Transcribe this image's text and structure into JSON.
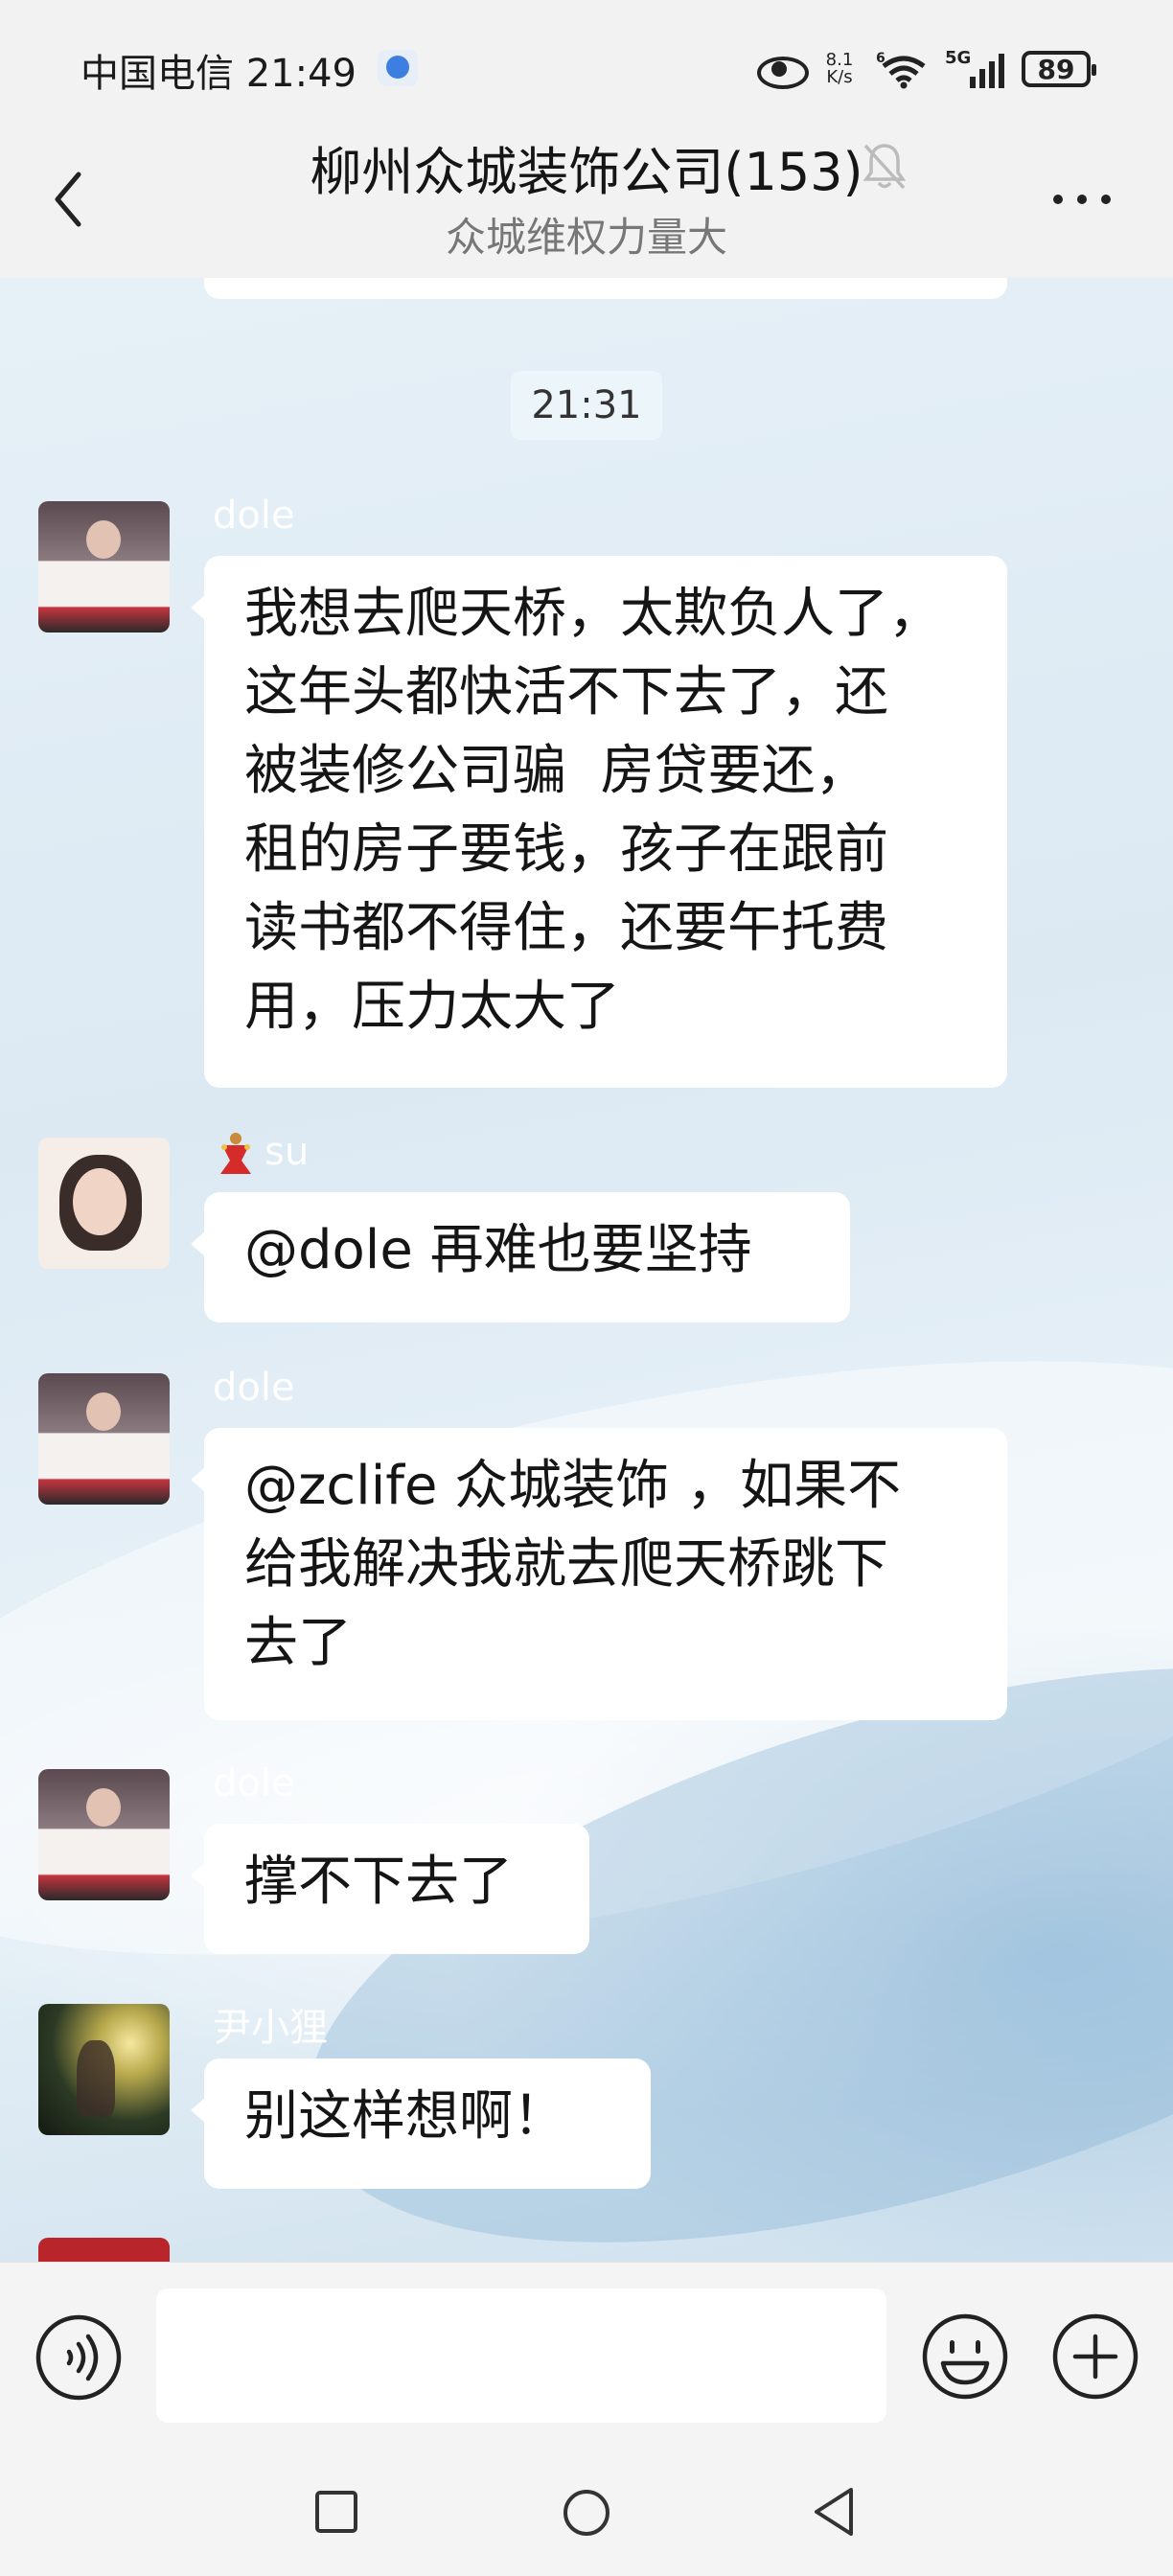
{
  "status_bar": {
    "carrier_time": "中国电信 21:49",
    "net_speed_value": "8.1",
    "net_speed_unit": "K/s",
    "network_gen": "5G",
    "wifi_gen": "6",
    "battery": "89"
  },
  "header": {
    "title": "柳州众城装饰公司(153)",
    "subtitle": "众城维权力量大"
  },
  "chat": {
    "time_divider": "21:31",
    "messages": [
      {
        "sender": "dole",
        "avatar_icon": "profile-photo",
        "text": "我想去爬天桥，太欺负人了，\n这年头都快活不下去了，还\n被装修公司骗  房贷要还，\n租的房子要钱，孩子在跟前\n读书都不得住，还要午托费\n用，压力太大了"
      },
      {
        "sender": "su",
        "avatar_icon": "profile-photo",
        "badge_icon": "dancer-emoji",
        "text": "@dole  再难也要坚持"
      },
      {
        "sender": "dole",
        "avatar_icon": "profile-photo",
        "text": "@zclife 众城装饰 ，如果不\n给我解决我就去爬天桥跳下\n去了"
      },
      {
        "sender": "dole",
        "avatar_icon": "profile-photo",
        "text": "撑不下去了"
      },
      {
        "sender": "尹小狸",
        "avatar_icon": "profile-photo",
        "text": "别这样想啊！"
      }
    ]
  },
  "input_bar": {
    "placeholder": "",
    "value": ""
  },
  "colors": {
    "header_bg": "#f2f2f2",
    "bubble_bg": "#ffffff",
    "sender_name": "#ffffff",
    "chat_bg": "#dce9f3"
  }
}
